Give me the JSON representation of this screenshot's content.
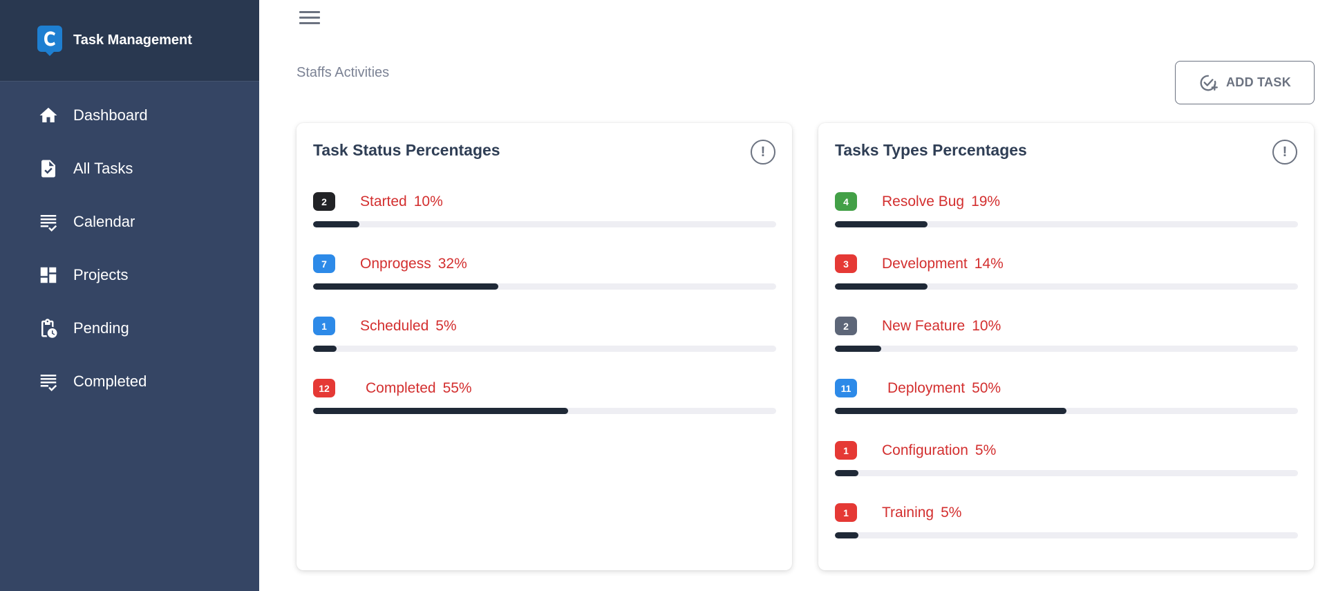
{
  "app": {
    "brand": "Task Management"
  },
  "sidebar": {
    "items": [
      {
        "label": "Dashboard",
        "icon": "home-icon"
      },
      {
        "label": "All Tasks",
        "icon": "task-doc-icon"
      },
      {
        "label": "Calendar",
        "icon": "checklist-icon"
      },
      {
        "label": "Projects",
        "icon": "dashboard-grid-icon"
      },
      {
        "label": "Pending",
        "icon": "clipboard-clock-icon"
      },
      {
        "label": "Completed",
        "icon": "checklist-icon"
      }
    ]
  },
  "header": {
    "subtitle": "Staffs Activities",
    "add_task_label": "ADD TASK"
  },
  "status_card": {
    "title": "Task Status Percentages",
    "rows": [
      {
        "count": "2",
        "label": "Started",
        "pct": "10%",
        "value": 10,
        "badge_color": "#222326"
      },
      {
        "count": "7",
        "label": "Onprogess",
        "pct": "32%",
        "value": 40,
        "badge_color": "#2d8ae8"
      },
      {
        "count": "1",
        "label": "Scheduled",
        "pct": "5%",
        "value": 5,
        "badge_color": "#2d8ae8"
      },
      {
        "count": "12",
        "label": "Completed",
        "pct": "55%",
        "value": 55,
        "badge_color": "#e53935"
      }
    ]
  },
  "types_card": {
    "title": "Tasks Types Percentages",
    "rows": [
      {
        "count": "4",
        "label": "Resolve Bug",
        "pct": "19%",
        "value": 20,
        "badge_color": "#43a047"
      },
      {
        "count": "3",
        "label": "Development",
        "pct": "14%",
        "value": 20,
        "badge_color": "#e53935"
      },
      {
        "count": "2",
        "label": "New Feature",
        "pct": "10%",
        "value": 10,
        "badge_color": "#5d6678"
      },
      {
        "count": "11",
        "label": "Deployment",
        "pct": "50%",
        "value": 50,
        "badge_color": "#2d8ae8"
      },
      {
        "count": "1",
        "label": "Configuration",
        "pct": "5%",
        "value": 5,
        "badge_color": "#e53935"
      },
      {
        "count": "1",
        "label": "Training",
        "pct": "5%",
        "value": 5,
        "badge_color": "#e53935"
      }
    ]
  },
  "colors": {
    "sidebar_bg": "#354564",
    "sidebar_header_bg": "#293850",
    "label_red": "#d32f2f",
    "bar_fill": "#1f2937",
    "bar_track": "#eeeef3"
  }
}
